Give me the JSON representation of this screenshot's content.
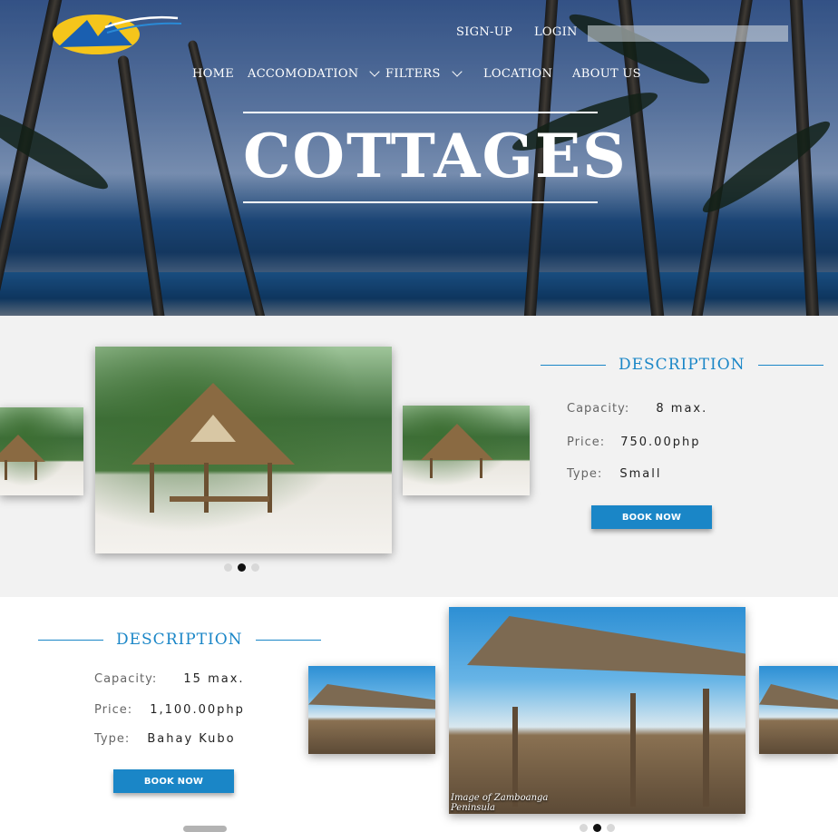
{
  "header": {
    "top_links": [
      "SIGN-UP",
      "LOGIN"
    ],
    "search_placeholder": "",
    "nav": {
      "home": "HOME",
      "accomodation": "ACCOMODATION",
      "filters": "FILTERS",
      "location": "LOCATION",
      "about": "ABOUT US"
    },
    "title": "COTTAGES"
  },
  "cottages": [
    {
      "heading": "DESCRIPTION",
      "capacity_label": "Capacity:",
      "capacity_value": "8 max.",
      "price_label": "Price:",
      "price_value": "750.00php",
      "type_label": "Type:",
      "type_value": "Small",
      "button": "BOOK NOW",
      "carousel_active_index": 1,
      "carousel_count": 3
    },
    {
      "heading": "DESCRIPTION",
      "capacity_label": "Capacity:",
      "capacity_value": "15 max.",
      "price_label": "Price:",
      "price_value": "1,100.00php",
      "type_label": "Type:",
      "type_value": "Bahay Kubo",
      "button": "BOOK NOW",
      "watermark": "Image of Zamboanga Peninsula",
      "carousel_active_index": 1,
      "carousel_count": 3
    }
  ],
  "colors": {
    "accent": "#1a86c7",
    "section_bg": "#f2f2f2"
  }
}
